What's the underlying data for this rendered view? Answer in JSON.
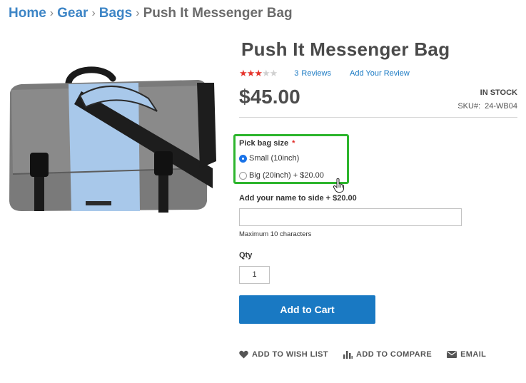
{
  "breadcrumb": {
    "home": "Home",
    "gear": "Gear",
    "bags": "Bags",
    "current": "Push It Messenger Bag",
    "separator": "›"
  },
  "product": {
    "title": "Push It Messenger Bag",
    "rating": {
      "stars": 3,
      "max": 5,
      "reviews_count": "3",
      "reviews_label": "Reviews",
      "add_review": "Add Your Review"
    },
    "price": "$45.00",
    "stock": "IN STOCK",
    "sku_label": "SKU#:",
    "sku_value": "24-WB04"
  },
  "options": {
    "label": "Pick bag size",
    "required_mark": "*",
    "choices": [
      {
        "label": "Small (10inch)",
        "selected": true
      },
      {
        "label": "Big (20inch) + $20.00",
        "selected": false
      }
    ]
  },
  "custom_name": {
    "label": "Add your name to side + $20.00",
    "value": "",
    "note": "Maximum 10 characters"
  },
  "qty": {
    "label": "Qty",
    "value": "1"
  },
  "cart_button": "Add to Cart",
  "actions": {
    "wishlist": "ADD TO WISH LIST",
    "compare": "ADD TO COMPARE",
    "email": "EMAIL"
  },
  "colors": {
    "link": "#3d85c6",
    "accent_blue": "#1979c3",
    "highlight_green": "#2db52d",
    "star_red": "#e5342c"
  },
  "icons": {
    "wishlist": "heart-icon",
    "compare": "bar-chart-icon",
    "email": "envelope-icon",
    "cursor": "hand-pointer-icon"
  }
}
